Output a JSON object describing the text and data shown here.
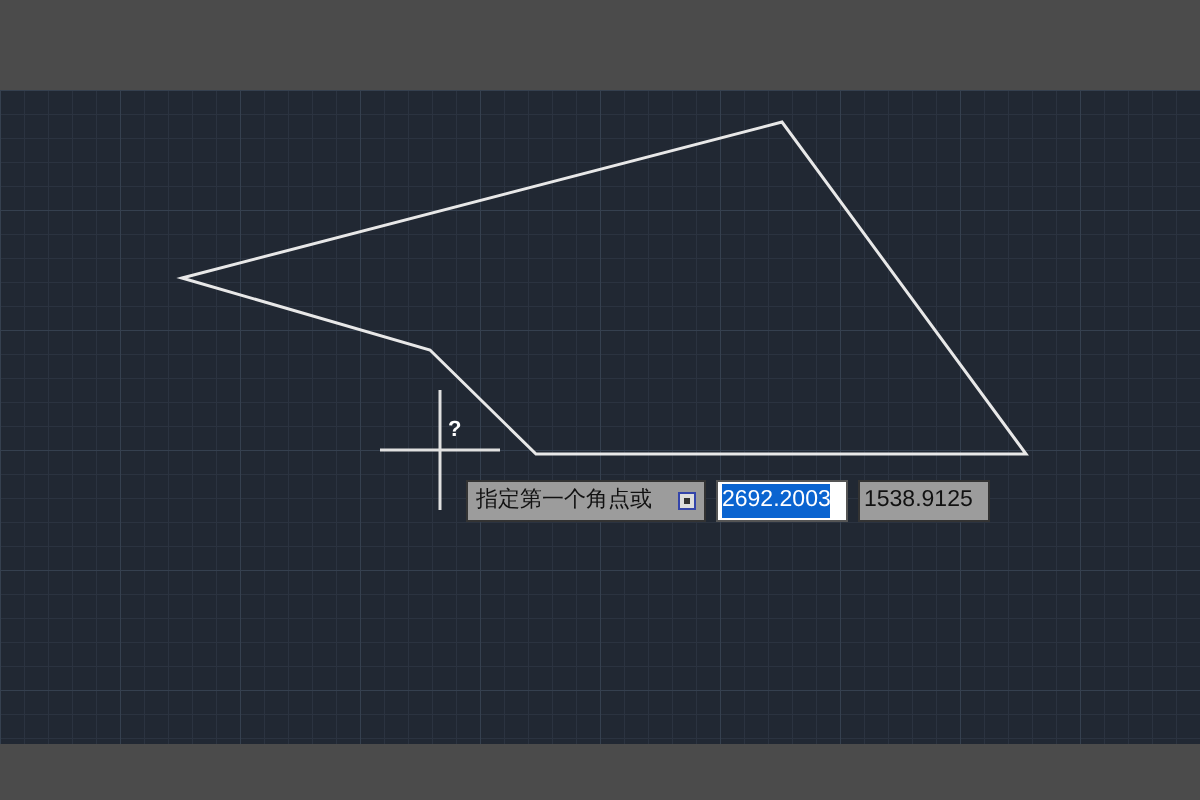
{
  "cursor": {
    "marker": "?"
  },
  "dynamic_input": {
    "prompt": "指定第一个角点或",
    "fields": [
      {
        "value": "2692.2003",
        "selected": true
      },
      {
        "value": "1538.9125",
        "selected": false
      }
    ]
  }
}
